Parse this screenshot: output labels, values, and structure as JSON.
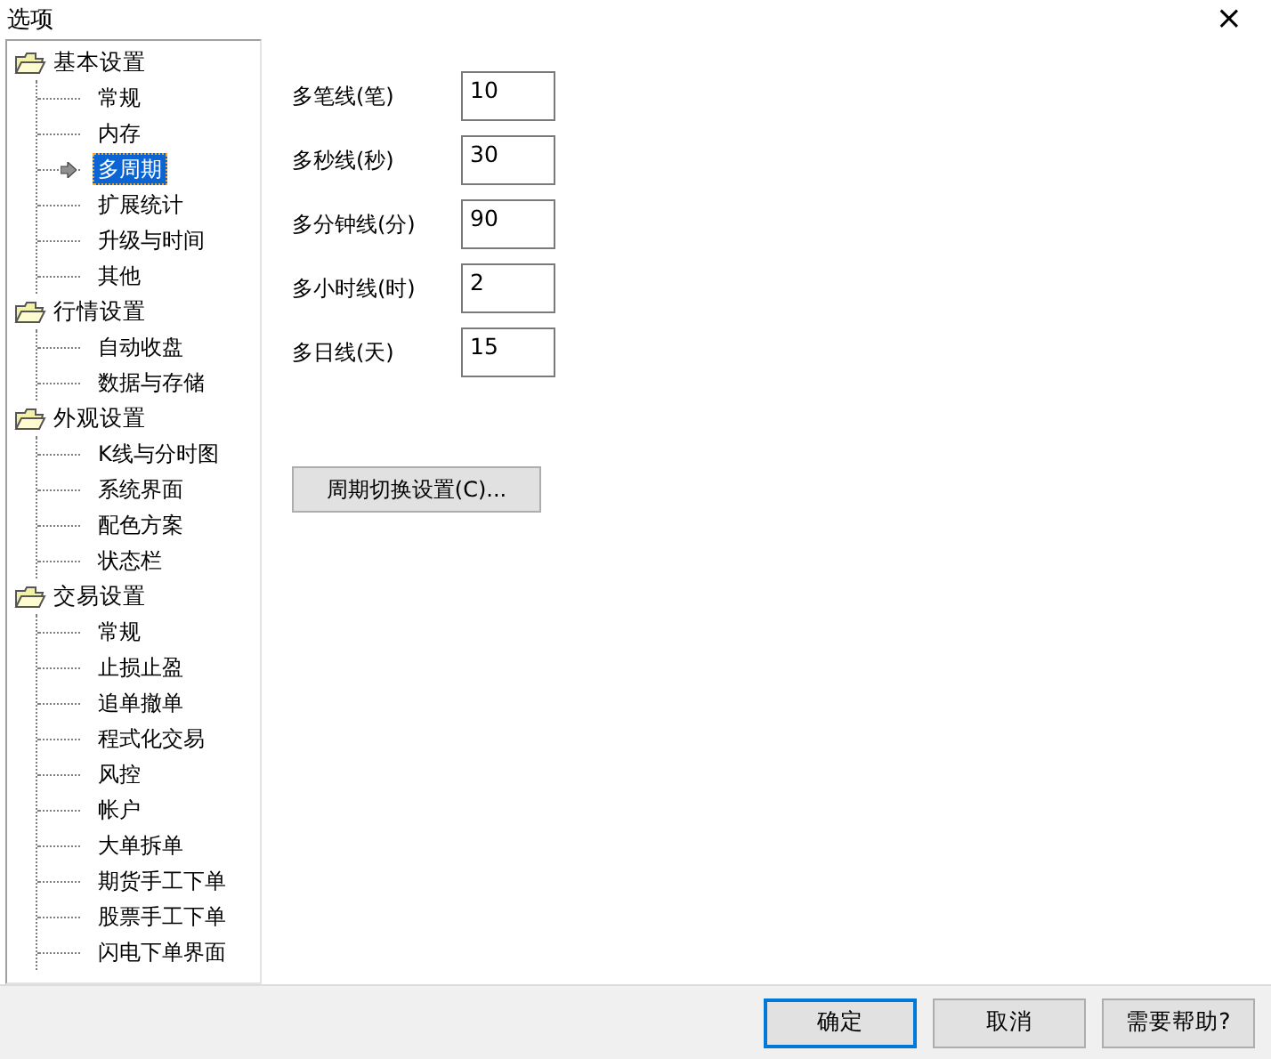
{
  "window": {
    "title": "选项",
    "close": "×"
  },
  "tree": [
    {
      "label": "基本设置",
      "expanded": true,
      "children": [
        {
          "label": "常规",
          "selected": false
        },
        {
          "label": "内存",
          "selected": false
        },
        {
          "label": "多周期",
          "selected": true
        },
        {
          "label": "扩展统计",
          "selected": false
        },
        {
          "label": "升级与时间",
          "selected": false
        },
        {
          "label": "其他",
          "selected": false
        }
      ]
    },
    {
      "label": "行情设置",
      "expanded": true,
      "children": [
        {
          "label": "自动收盘",
          "selected": false
        },
        {
          "label": "数据与存储",
          "selected": false
        }
      ]
    },
    {
      "label": "外观设置",
      "expanded": true,
      "children": [
        {
          "label": "K线与分时图",
          "selected": false
        },
        {
          "label": "系统界面",
          "selected": false
        },
        {
          "label": "配色方案",
          "selected": false
        },
        {
          "label": "状态栏",
          "selected": false
        }
      ]
    },
    {
      "label": "交易设置",
      "expanded": true,
      "children": [
        {
          "label": "常规",
          "selected": false
        },
        {
          "label": "止损止盈",
          "selected": false
        },
        {
          "label": "追单撤单",
          "selected": false
        },
        {
          "label": "程式化交易",
          "selected": false
        },
        {
          "label": "风控",
          "selected": false
        },
        {
          "label": "帐户",
          "selected": false
        },
        {
          "label": "大单拆单",
          "selected": false
        },
        {
          "label": "期货手工下单",
          "selected": false
        },
        {
          "label": "股票手工下单",
          "selected": false
        },
        {
          "label": "闪电下单界面",
          "selected": false
        }
      ]
    }
  ],
  "fields": [
    {
      "label": "多笔线(笔)",
      "value": "10"
    },
    {
      "label": "多秒线(秒)",
      "value": "30"
    },
    {
      "label": "多分钟线(分)",
      "value": "90"
    },
    {
      "label": "多小时线(时)",
      "value": "2"
    },
    {
      "label": "多日线(天)",
      "value": "15"
    }
  ],
  "settings_button": "周期切换设置(C)...",
  "buttons": [
    {
      "label": "确定",
      "default": true
    },
    {
      "label": "取消",
      "default": false
    },
    {
      "label": "需要帮助?",
      "default": false
    }
  ]
}
